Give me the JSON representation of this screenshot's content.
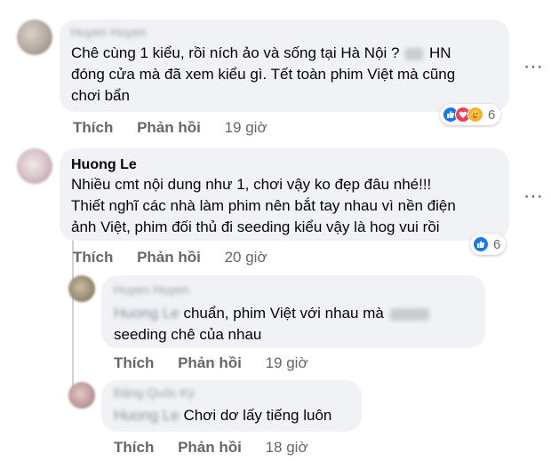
{
  "comments": [
    {
      "author": "Huyen Huyen",
      "lines": [
        "Chê cùng 1 kiểu, rồi ních ảo và sống tại Hà Nội ?",
        "HN",
        "đóng cửa mà đã xem kiểu gì. Tết toàn phim Việt mà cũng",
        "chơi bẩn"
      ],
      "reaction_count": "6",
      "time": "19 giờ"
    },
    {
      "author": "Huong Le",
      "lines": [
        "Nhiều cmt nội dung như 1, chơi vậy ko đẹp đâu nhé!!!",
        "Thiết nghĩ các nhà làm phim nên bắt tay nhau vì nền điện",
        "ảnh Việt, phim đối thủ đi seeding kiểu vậy là hog vui rồi"
      ],
      "reaction_count": "6",
      "time": "20 giờ"
    }
  ],
  "replies": [
    {
      "author": "Huyen Huyen",
      "mention": "Huong Le",
      "line1": "chuẩn, phim Việt với nhau mà",
      "line2": "seeding chê của nhau",
      "time": "19 giờ"
    },
    {
      "author": "Đặng Quốc Kỳ",
      "mention": "Huong Le",
      "line1": "Chơi dơ lấy tiếng luôn",
      "time": "18 giờ"
    }
  ],
  "actions": {
    "like": "Thích",
    "reply": "Phản hồi"
  },
  "more_icon": "⋯",
  "icons": [
    "like-reaction-icon",
    "love-reaction-icon",
    "care-reaction-icon",
    "more-options-icon"
  ],
  "colors": {
    "like": "#1877f2",
    "love": "#f33e58",
    "care": "#f7b125",
    "bubble": "#f0f2f5",
    "muted": "#65676b"
  }
}
